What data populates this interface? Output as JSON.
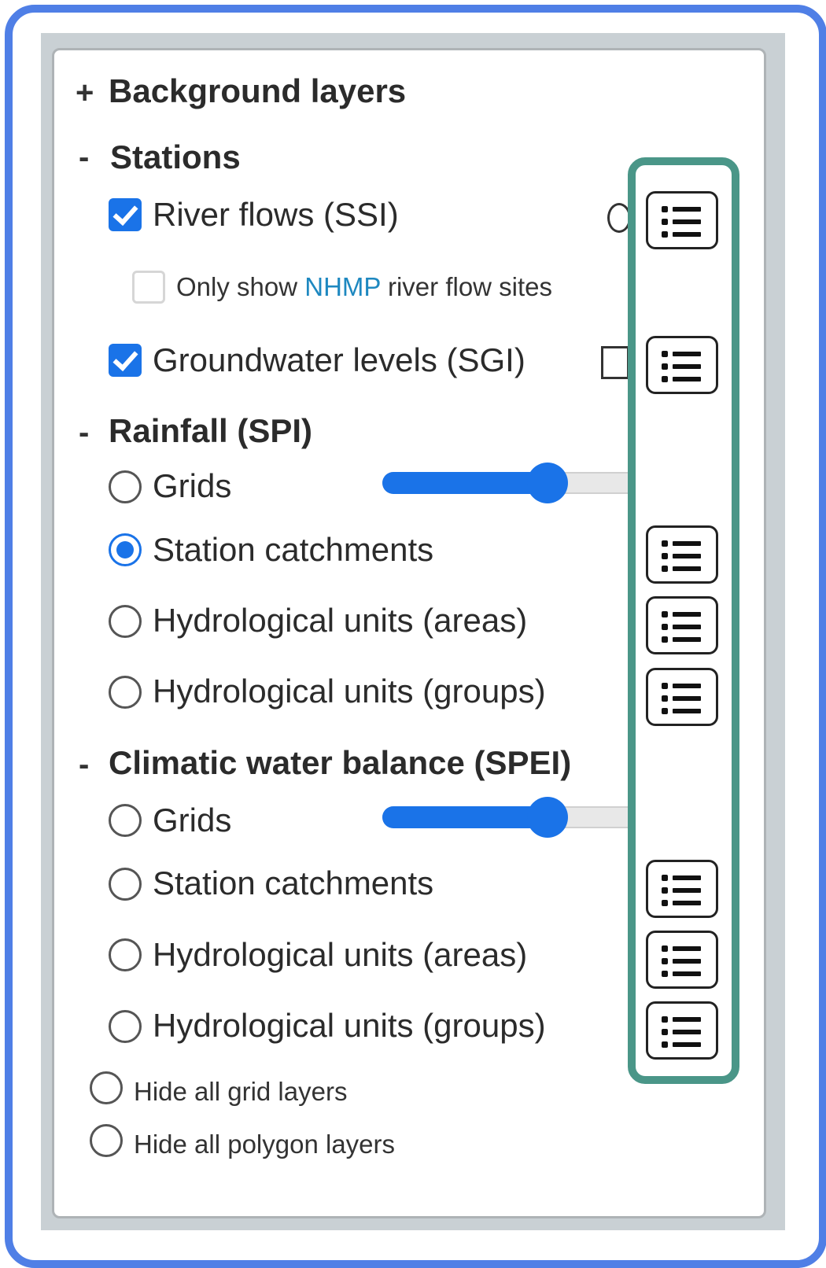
{
  "background_layers": {
    "toggle": "+",
    "label": "Background layers"
  },
  "stations": {
    "toggle": "-",
    "title": "Stations",
    "river_flows": {
      "label": "River flows (SSI)",
      "checked": true
    },
    "nhmp": {
      "prefix": "Only show ",
      "link": "NHMP",
      "suffix": " river flow sites",
      "checked": false
    },
    "groundwater": {
      "label": "Groundwater levels (SGI)",
      "checked": true
    }
  },
  "rainfall": {
    "toggle": "-",
    "title": "Rainfall (SPI)",
    "options": [
      {
        "label": "Grids",
        "selected": false,
        "opacity": 0.5
      },
      {
        "label": "Station catchments",
        "selected": true
      },
      {
        "label": "Hydrological units (areas)",
        "selected": false
      },
      {
        "label": "Hydrological units (groups)",
        "selected": false
      }
    ]
  },
  "cwb": {
    "toggle": "-",
    "title": "Climatic water balance (SPEI)",
    "options": [
      {
        "label": "Grids",
        "selected": false,
        "opacity": 0.5
      },
      {
        "label": "Station catchments",
        "selected": false
      },
      {
        "label": "Hydrological units (areas)",
        "selected": false
      },
      {
        "label": "Hydrological units (groups)",
        "selected": false
      }
    ]
  },
  "hide": {
    "grid": "Hide all grid layers",
    "polygon": "Hide all polygon layers"
  },
  "colors": {
    "accent": "#1a73e8",
    "frame": "#4f7fe6",
    "highlight": "#4a9688",
    "link": "#1e88c0"
  },
  "icons": {
    "legend": "list-icon"
  }
}
